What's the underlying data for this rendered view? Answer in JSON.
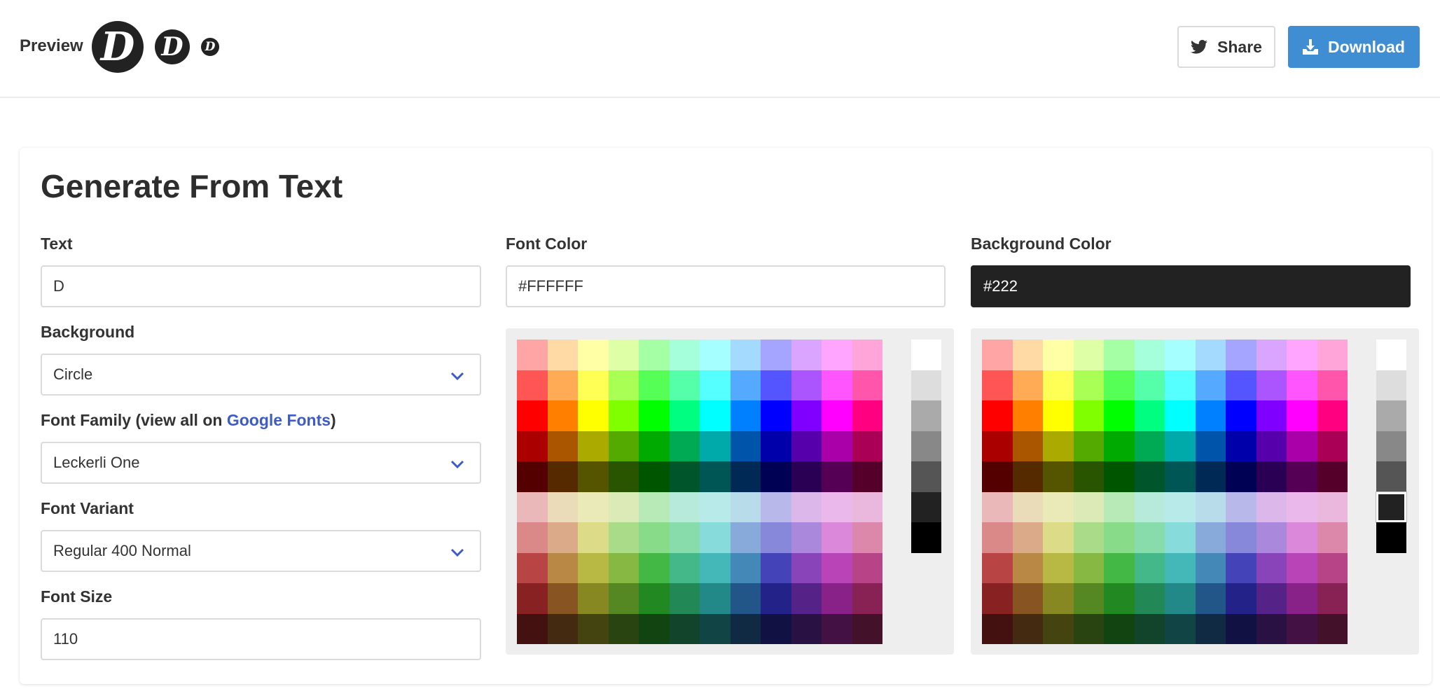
{
  "header": {
    "preview_label": "Preview",
    "logo_letter": "D",
    "share_label": "Share",
    "download_label": "Download"
  },
  "card": {
    "title": "Generate From Text",
    "text_label": "Text",
    "text_value": "D",
    "background_label": "Background",
    "background_value": "Circle",
    "font_family_label_prefix": "Font Family (view all on ",
    "font_family_link": "Google Fonts",
    "font_family_label_suffix": ")",
    "font_family_value": "Leckerli One",
    "font_variant_label": "Font Variant",
    "font_variant_value": "Regular 400 Normal",
    "font_size_label": "Font Size",
    "font_size_value": "110",
    "font_color_label": "Font Color",
    "font_color_value": "#FFFFFF",
    "background_color_label": "Background Color",
    "background_color_value": "#222"
  },
  "colors": {
    "accent": "#3f8ed4",
    "link": "#3d5cc9",
    "logo_bg": "#222222",
    "logo_fg": "#ffffff"
  },
  "palette": {
    "rows": [
      [
        "#ffa5a5",
        "#ffdaa5",
        "#ffffa5",
        "#deffa5",
        "#a5ffa5",
        "#a5ffda",
        "#a5ffff",
        "#a5daff",
        "#a5a5ff",
        "#daa5ff",
        "#ffa5ff",
        "#ffa5da"
      ],
      [
        "#ff5555",
        "#ffaa55",
        "#ffff55",
        "#aaff55",
        "#55ff55",
        "#55ffaa",
        "#55ffff",
        "#55aaff",
        "#5555ff",
        "#aa55ff",
        "#ff55ff",
        "#ff55aa"
      ],
      [
        "#ff0000",
        "#ff8000",
        "#ffff00",
        "#80ff00",
        "#00ff00",
        "#00ff80",
        "#00ffff",
        "#0080ff",
        "#0000ff",
        "#8000ff",
        "#ff00ff",
        "#ff0080"
      ],
      [
        "#aa0000",
        "#aa5500",
        "#aaaa00",
        "#55aa00",
        "#00aa00",
        "#00aa55",
        "#00aaaa",
        "#0055aa",
        "#0000aa",
        "#5500aa",
        "#aa00aa",
        "#aa0055"
      ],
      [
        "#550000",
        "#552a00",
        "#555500",
        "#2a5500",
        "#005500",
        "#00552a",
        "#005555",
        "#002a55",
        "#000055",
        "#2a0055",
        "#550055",
        "#55002a"
      ],
      [
        "#eab8b8",
        "#eadcb8",
        "#eaeab8",
        "#dceab8",
        "#b8eab8",
        "#b8eadc",
        "#b8eaea",
        "#b8dcea",
        "#b8b8ea",
        "#dcb8ea",
        "#eab8ea",
        "#eab8dc"
      ],
      [
        "#db8888",
        "#dbaa88",
        "#dbdb88",
        "#aadb88",
        "#88db88",
        "#88dbaa",
        "#88dbdb",
        "#88aadb",
        "#8888db",
        "#aa88db",
        "#db88db",
        "#db88aa"
      ],
      [
        "#b84444",
        "#b88844",
        "#b8b844",
        "#88b844",
        "#44b844",
        "#44b888",
        "#44b8b8",
        "#4488b8",
        "#4444b8",
        "#8844b8",
        "#b844b8",
        "#b84488"
      ],
      [
        "#882222",
        "#885522",
        "#888822",
        "#558822",
        "#228822",
        "#228855",
        "#228888",
        "#225588",
        "#222288",
        "#552288",
        "#882288",
        "#882255"
      ],
      [
        "#441111",
        "#442a11",
        "#444411",
        "#2a4411",
        "#114411",
        "#11442a",
        "#114444",
        "#112a44",
        "#111144",
        "#2a1144",
        "#441144",
        "#44112a"
      ]
    ],
    "grays": [
      "#ffffff",
      "#dddddd",
      "#aaaaaa",
      "#888888",
      "#555555",
      "#222222",
      "#000000"
    ],
    "font_selected_gray": "",
    "bg_selected_gray": "#222222"
  }
}
